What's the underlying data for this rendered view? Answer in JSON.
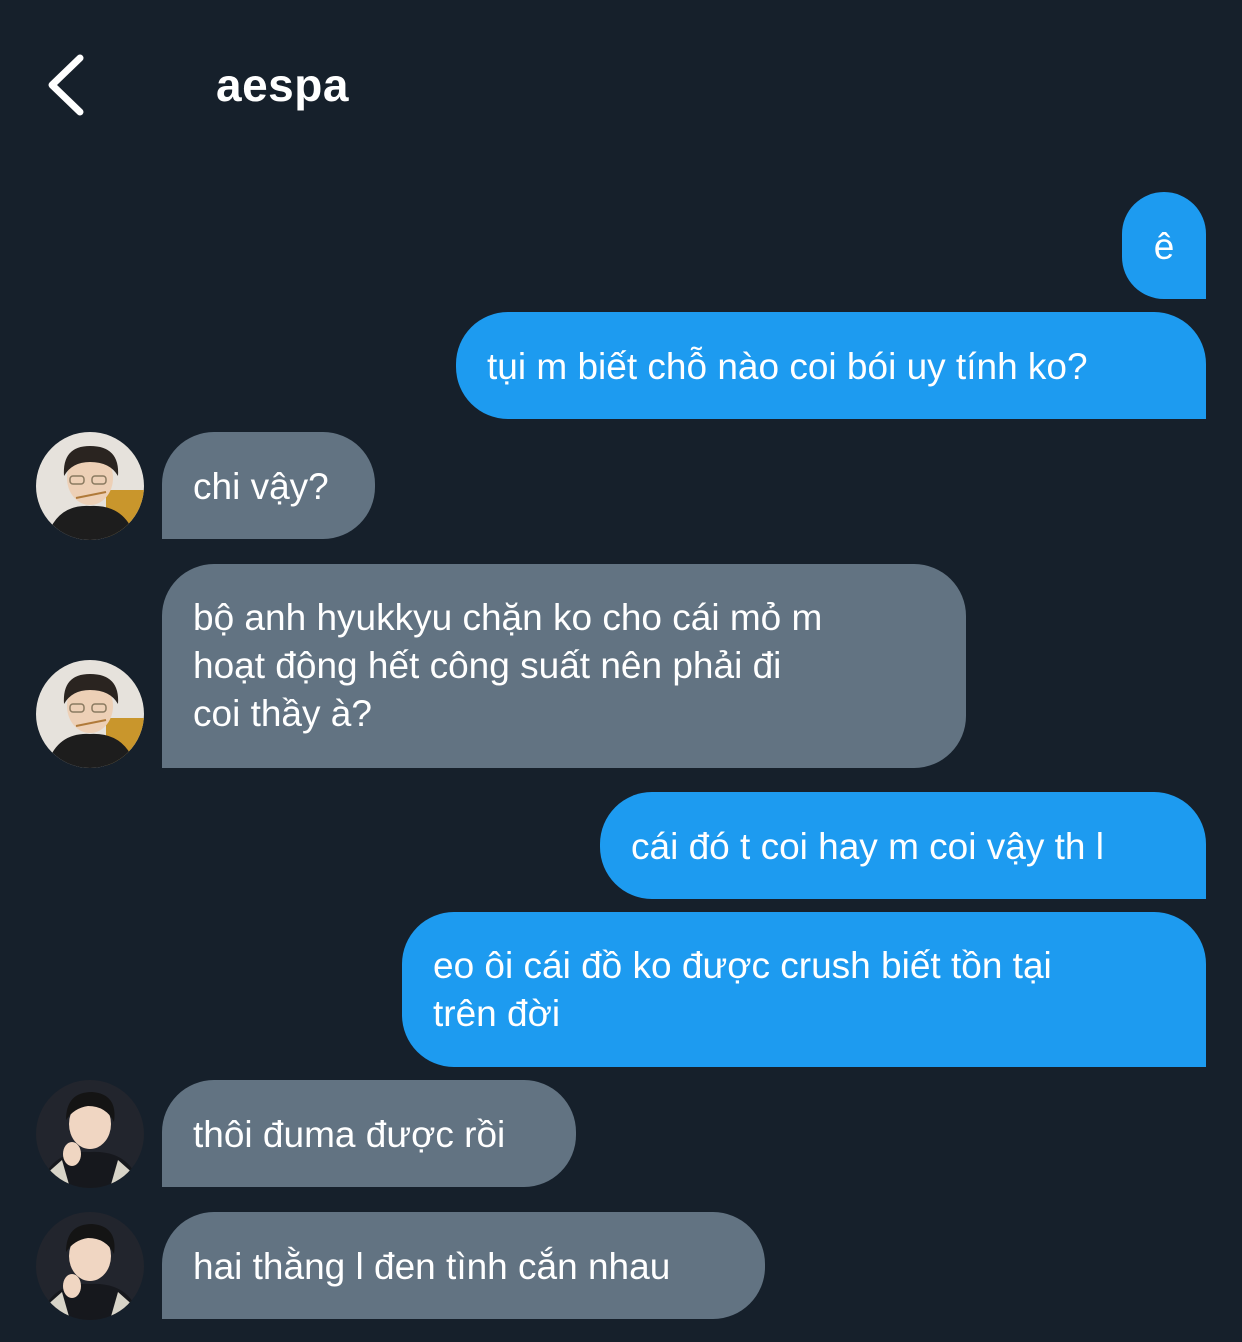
{
  "header": {
    "title": "aespa",
    "back_icon": "chevron-left-icon"
  },
  "messages": [
    {
      "sender": "me",
      "text": "ê"
    },
    {
      "sender": "me",
      "text": "tụi m biết chỗ nào coi bói uy tính ko?"
    },
    {
      "sender": "other",
      "text": "chi vậy?"
    },
    {
      "sender": "other",
      "lines": [
        "bộ anh hyukkyu chặn ko cho cái mỏ m",
        "hoạt động hết công suất nên phải đi",
        "coi thầy à?"
      ]
    },
    {
      "sender": "me",
      "text": "cái đó t coi hay m coi vậy th l"
    },
    {
      "sender": "me",
      "lines": [
        "eo ôi cái đồ ko được crush biết tồn tại",
        "trên đời"
      ]
    },
    {
      "sender": "other",
      "text": "thôi đuma được rồi"
    },
    {
      "sender": "other",
      "text": "hai thằng l đen tình cắn nhau"
    }
  ],
  "colors": {
    "background": "#16202b",
    "sent_bubble": "#1d9bf0",
    "received_bubble": "#627382"
  }
}
